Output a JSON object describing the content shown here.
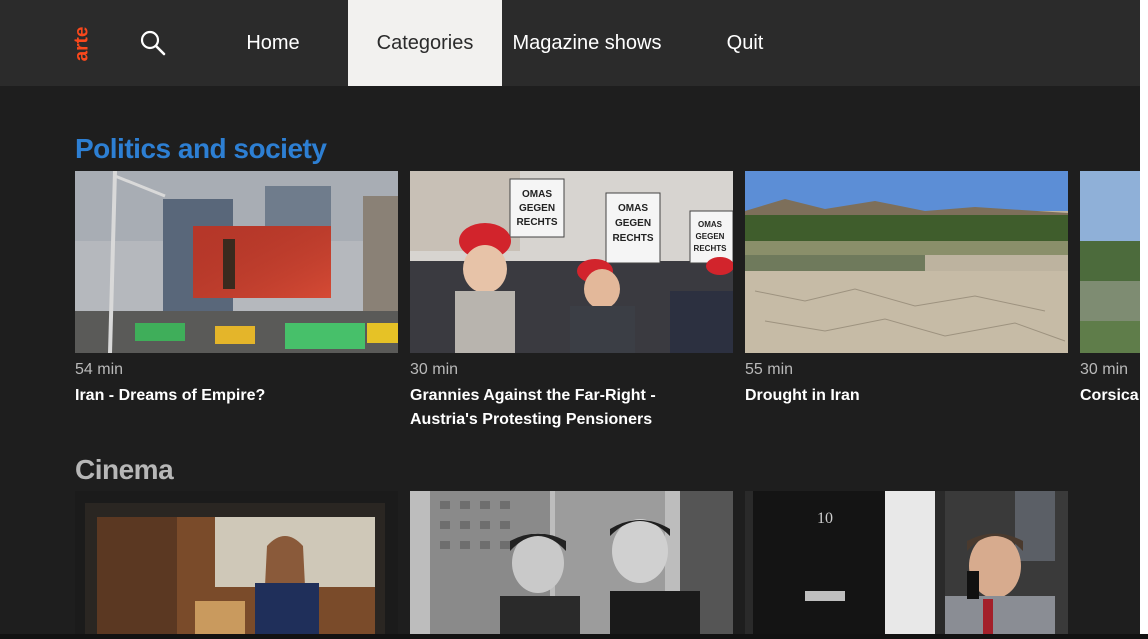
{
  "logo": {
    "text": "arte",
    "color": "#fa481c"
  },
  "nav": {
    "search_icon": "search-icon",
    "items": [
      {
        "label": "Home"
      },
      {
        "label": "Categories",
        "active": true
      },
      {
        "label": "Magazine shows"
      },
      {
        "label": "Quit"
      }
    ]
  },
  "rails": [
    {
      "title": "Politics and society",
      "title_color": "#2d7fd3",
      "cards": [
        {
          "duration": "54 min",
          "title": "Iran - Dreams of Empire?"
        },
        {
          "duration": "30 min",
          "title": "Grannies Against the Far-Right - Austria's Protesting Pensioners"
        },
        {
          "duration": "55 min",
          "title": "Drought in Iran"
        },
        {
          "duration": "30 min",
          "title": "Corsica fo"
        }
      ]
    },
    {
      "title": "Cinema",
      "title_color": "#b7b7b7",
      "cards": [
        {
          "image": "woman-on-tv-screen"
        },
        {
          "image": "two-men-black-and-white"
        },
        {
          "image": "man-on-phone-at-door-10"
        }
      ]
    }
  ],
  "images": {
    "protest_signs": [
      "OMAS GEGEN RECHTS",
      "OMAS GEGEN RECHTS",
      "OMAS GEGEN RECHTS"
    ],
    "door_number": "10"
  }
}
